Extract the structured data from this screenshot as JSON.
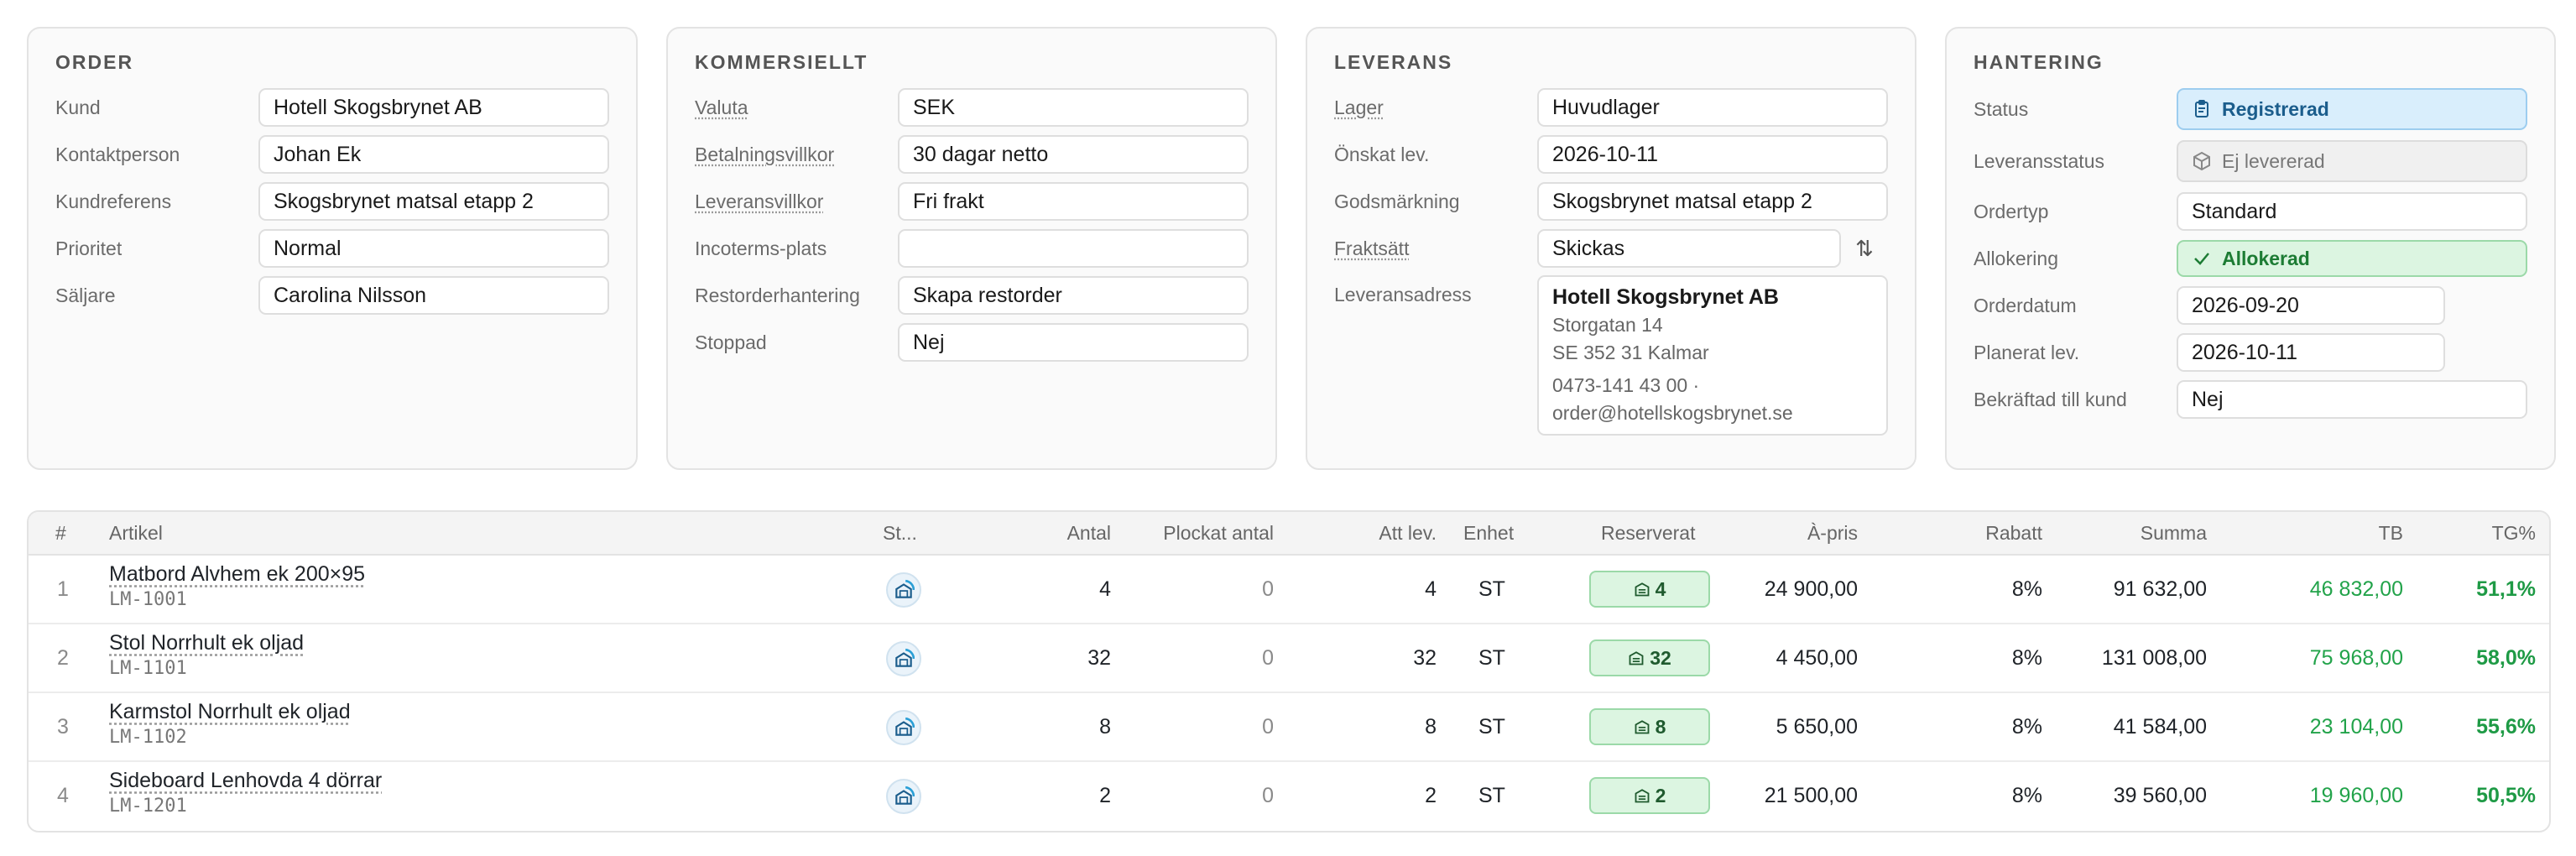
{
  "order": {
    "title": "ORDER",
    "rows": [
      {
        "label": "Kund",
        "value": "Hotell Skogsbrynet AB"
      },
      {
        "label": "Kontaktperson",
        "value": "Johan Ek"
      },
      {
        "label": "Kundreferens",
        "value": "Skogsbrynet matsal etapp 2"
      },
      {
        "label": "Prioritet",
        "value": "Normal"
      },
      {
        "label": "Säljare",
        "value": "Carolina Nilsson"
      }
    ]
  },
  "commercial": {
    "title": "KOMMERSIELLT",
    "rows": [
      {
        "label": "Valuta",
        "value": "SEK"
      },
      {
        "label": "Betalningsvillkor",
        "value": "30 dagar netto"
      },
      {
        "label": "Leveransvillkor",
        "value": "Fri frakt"
      },
      {
        "label": "Incoterms-plats",
        "value": ""
      },
      {
        "label": "Restorderhantering",
        "value": "Skapa restorder"
      },
      {
        "label": "Stoppad",
        "value": "Nej"
      }
    ]
  },
  "delivery": {
    "title": "LEVERANS",
    "rows": [
      {
        "label": "Lager",
        "value": "Huvudlager"
      },
      {
        "label": "Önskat lev.",
        "value": "2026-10-11"
      },
      {
        "label": "Godsmärkning",
        "value": "Skogsbrynet matsal etapp 2"
      },
      {
        "label": "Fraktsätt",
        "value": "Skickas"
      }
    ],
    "address_label": "Leveransadress",
    "address": {
      "name": "Hotell Skogsbrynet AB",
      "street": "Storgatan 14",
      "city": "SE 352 31 Kalmar",
      "phone": "0473-141 43 00 ·",
      "email": "order@hotellskogsbrynet.se"
    }
  },
  "handling": {
    "title": "HANTERING",
    "status_label": "Status",
    "status_value": "Registrerad",
    "delivery_status_label": "Leveransstatus",
    "delivery_status_value": "Ej levererad",
    "order_type_label": "Ordertyp",
    "order_type_value": "Standard",
    "allocation_label": "Allokering",
    "allocation_value": "Allokerad",
    "order_date_label": "Orderdatum",
    "order_date_value": "2026-09-20",
    "planned_label": "Planerat lev.",
    "planned_value": "2026-10-11",
    "confirmed_label": "Bekräftad till kund",
    "confirmed_value": "Nej"
  },
  "table": {
    "headers": {
      "num": "#",
      "article": "Artikel",
      "status": "St...",
      "qty": "Antal",
      "picked": "Plockat antal",
      "to_deliver": "Att lev.",
      "unit": "Enhet",
      "reserved": "Reserverat",
      "price": "À-pris",
      "discount": "Rabatt",
      "sum": "Summa",
      "tb": "TB",
      "tg": "TG%"
    },
    "rows": [
      {
        "num": "1",
        "name": "Matbord Alvhem ek 200×95",
        "sku": "LM-1001",
        "qty": "4",
        "picked": "0",
        "to_deliver": "4",
        "unit": "ST",
        "reserved": "4",
        "price": "24 900,00",
        "discount": "8%",
        "sum": "91 632,00",
        "tb": "46 832,00",
        "tg": "51,1%"
      },
      {
        "num": "2",
        "name": "Stol Norrhult ek oljad",
        "sku": "LM-1101",
        "qty": "32",
        "picked": "0",
        "to_deliver": "32",
        "unit": "ST",
        "reserved": "32",
        "price": "4 450,00",
        "discount": "8%",
        "sum": "131 008,00",
        "tb": "75 968,00",
        "tg": "58,0%"
      },
      {
        "num": "3",
        "name": "Karmstol Norrhult ek oljad",
        "sku": "LM-1102",
        "qty": "8",
        "picked": "0",
        "to_deliver": "8",
        "unit": "ST",
        "reserved": "8",
        "price": "5 650,00",
        "discount": "8%",
        "sum": "41 584,00",
        "tb": "23 104,00",
        "tg": "55,6%"
      },
      {
        "num": "4",
        "name": "Sideboard Lenhovda 4 dörrar",
        "sku": "LM-1201",
        "qty": "2",
        "picked": "0",
        "to_deliver": "2",
        "unit": "ST",
        "reserved": "2",
        "price": "21 500,00",
        "discount": "8%",
        "sum": "39 560,00",
        "tb": "19 960,00",
        "tg": "50,5%"
      }
    ]
  },
  "icons": {
    "status": "clipboard-icon",
    "delivery_status": "package-icon",
    "allocation": "check-icon",
    "freight_swap": "swap-vertical-icon",
    "row_status": "warehouse-progress-icon",
    "reserved": "warehouse-icon"
  },
  "colors": {
    "accent_blue": "#1b5d8c",
    "success_green": "#22a34a",
    "reserved_bg": "#dcf5e1"
  }
}
